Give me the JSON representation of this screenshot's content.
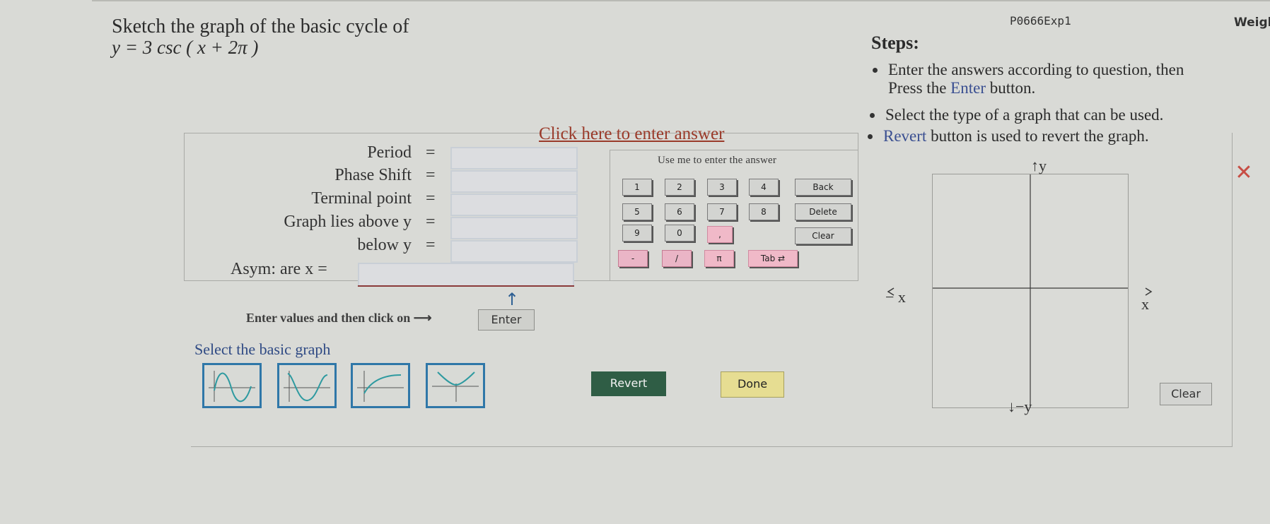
{
  "problem": {
    "id": "P0666Exp1",
    "title_fragment": "Weigl",
    "instruction": "Sketch the graph of the basic cycle of",
    "equation": "y = 3 csc ( x + 2π )"
  },
  "steps": {
    "heading": "Steps:",
    "items": [
      {
        "line1": "Enter the answers according to question, then",
        "line2_pre": "Press the ",
        "line2_link": "Enter",
        "line2_post": " button."
      },
      {
        "text": "Select the type of a graph that can be used."
      },
      {
        "pre": "",
        "link": "Revert",
        "post": " button is used to revert the graph."
      }
    ]
  },
  "form": {
    "click_here": "Click here to enter answer",
    "eq_sign": "=",
    "fields": [
      {
        "label": "Period",
        "value": ""
      },
      {
        "label": "Phase Shift",
        "value": ""
      },
      {
        "label": "Terminal point",
        "value": ""
      },
      {
        "label": "Graph lies above y",
        "value": ""
      },
      {
        "label": "below y",
        "value": ""
      }
    ],
    "asym_label": "Asym: are x =",
    "asym_value": "",
    "enter_prompt": "Enter values and then click on ⟶",
    "enter_button": "Enter",
    "select_graph_label": "Select the basic graph"
  },
  "keypad": {
    "title": "Use me to enter the answer",
    "keys": [
      "1",
      "2",
      "3",
      "4",
      "Back",
      "5",
      "6",
      "7",
      "8",
      "Delete",
      "9",
      "0",
      ",",
      "Clear",
      "-",
      "/",
      "π",
      "Tab ⇄"
    ]
  },
  "actions": {
    "revert": "Revert",
    "done": "Done",
    "clear": "Clear",
    "close": "✕"
  },
  "graph": {
    "y_top": "↑y",
    "y_bottom": "↓−y",
    "x_left": "− x",
    "x_right": "x"
  },
  "colors": {
    "accent_link": "#3a4f91",
    "click_here": "#9a3a2a",
    "revert_bg": "#2f5d45",
    "done_bg": "#e6dd92",
    "graph_btn_border": "#2f77a8",
    "curve": "#2e9aa0",
    "close": "#c74d44"
  }
}
